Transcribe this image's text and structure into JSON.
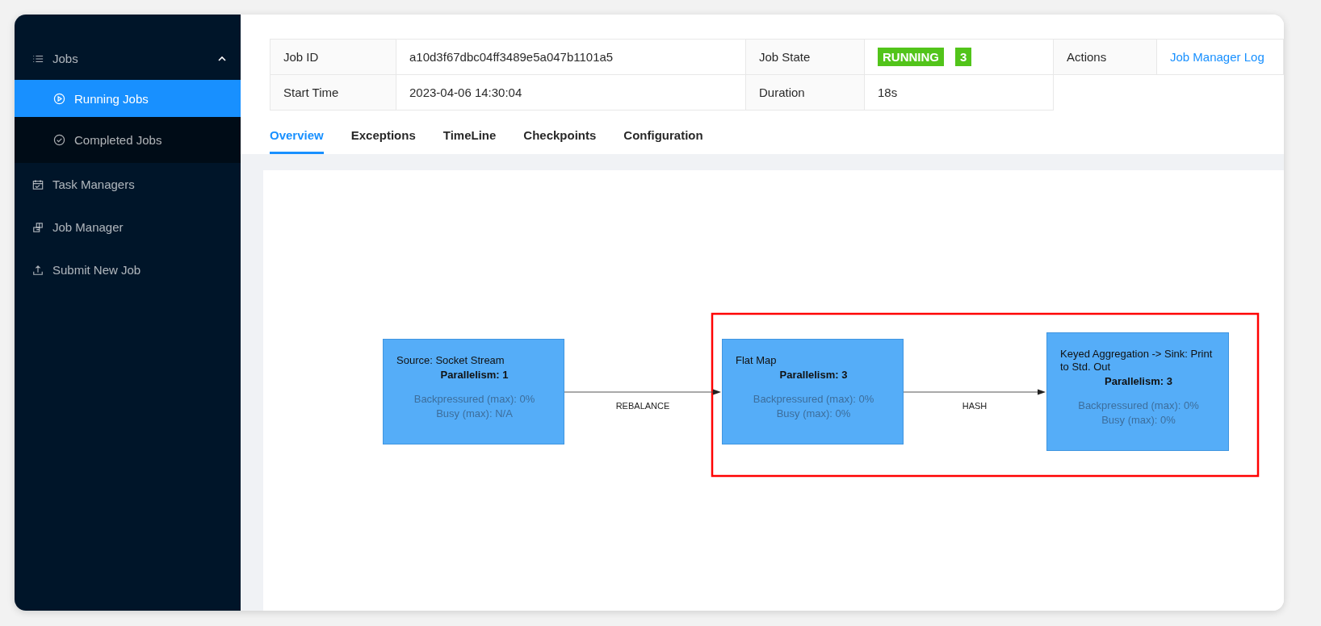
{
  "sidebar": {
    "items": [
      {
        "label": "Jobs",
        "selected": false,
        "expanded": true,
        "children": [
          {
            "label": "Running Jobs",
            "selected": true
          },
          {
            "label": "Completed Jobs",
            "selected": false
          }
        ]
      },
      {
        "label": "Task Managers",
        "selected": false
      },
      {
        "label": "Job Manager",
        "selected": false
      },
      {
        "label": "Submit New Job",
        "selected": false
      }
    ]
  },
  "job_details": {
    "rows": [
      [
        {
          "label": "Job ID",
          "value": {
            "kind": "text",
            "text": "a10d3f67dbc04ff3489e5a047b1101a5"
          }
        },
        {
          "label": "Job State",
          "value": {
            "kind": "status",
            "text": "RUNNING",
            "count": "3",
            "color": "#52c41a"
          }
        },
        {
          "label": "Actions",
          "value": {
            "kind": "link",
            "text": "Job Manager Log"
          }
        }
      ],
      [
        {
          "label": "Start Time",
          "value": {
            "kind": "text",
            "text": "2023-04-06 14:30:04"
          }
        },
        {
          "label": "Duration",
          "value": {
            "kind": "text",
            "text": "18s"
          }
        }
      ]
    ]
  },
  "tabs": [
    {
      "label": "Overview",
      "selected": true
    },
    {
      "label": "Exceptions",
      "selected": false
    },
    {
      "label": "TimeLine",
      "selected": false
    },
    {
      "label": "Checkpoints",
      "selected": false
    },
    {
      "label": "Configuration",
      "selected": false
    }
  ],
  "graph": {
    "nodes": [
      {
        "name": "Source: Socket Stream",
        "parallelism": "Parallelism: 1",
        "backpressured": "Backpressured (max): 0%",
        "busy": "Busy (max): N/A"
      },
      {
        "name": "Flat Map",
        "parallelism": "Parallelism: 3",
        "backpressured": "Backpressured (max): 0%",
        "busy": "Busy (max): 0%"
      },
      {
        "name": "Keyed Aggregation -> Sink: Print to Std. Out",
        "parallelism": "Parallelism: 3",
        "backpressured": "Backpressured (max): 0%",
        "busy": "Busy (max): 0%"
      }
    ],
    "edges": [
      {
        "label": "REBALANCE"
      },
      {
        "label": "HASH"
      }
    ],
    "highlight": {
      "color": "#ff0000"
    }
  }
}
